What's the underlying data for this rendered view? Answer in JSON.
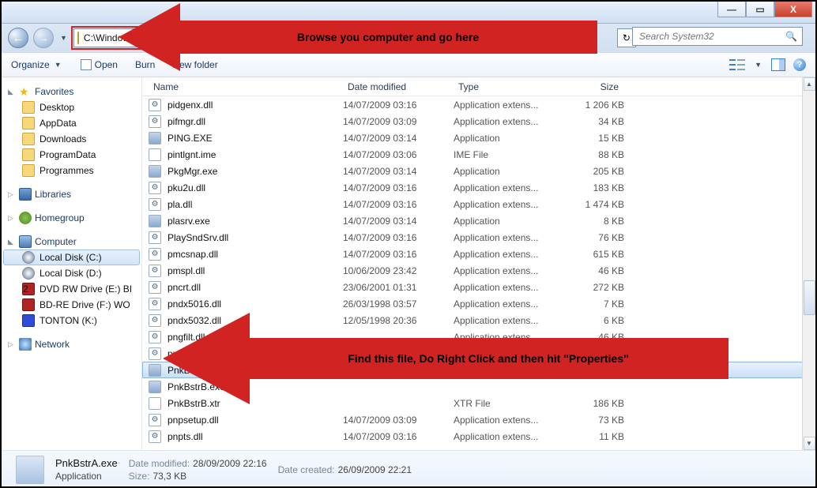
{
  "titlebar": {
    "minimize": "—",
    "maximize": "▭",
    "close": "X"
  },
  "nav": {
    "path": "C:\\Windows\\System32",
    "search_placeholder": "Search System32"
  },
  "annotations": {
    "top": "Browse you computer and go here",
    "mid": "Find this file, Do Right Click and then hit \"Properties\""
  },
  "toolbar": {
    "organize": "Organize",
    "open": "Open",
    "burn": "Burn",
    "newfolder": "New folder"
  },
  "navpane": {
    "favorites": "Favorites",
    "fav_items": [
      "Desktop",
      "AppData",
      "Downloads",
      "ProgramData",
      "Programmes"
    ],
    "libraries": "Libraries",
    "homegroup": "Homegroup",
    "computer": "Computer",
    "comp_items": [
      {
        "label": "Local Disk (C:)",
        "icon": "disc c",
        "sel": true
      },
      {
        "label": "Local Disk (D:)",
        "icon": "disc c"
      },
      {
        "label": "DVD RW Drive (E:) BI",
        "icon": "red",
        "prefix": "2"
      },
      {
        "label": "BD-RE Drive (F:) WO",
        "icon": "red"
      },
      {
        "label": "TONTON (K:)",
        "icon": "blue"
      }
    ],
    "network": "Network"
  },
  "columns": {
    "name": "Name",
    "date": "Date modified",
    "type": "Type",
    "size": "Size"
  },
  "files": [
    {
      "ic": "gear",
      "name": "pidgenx.dll",
      "date": "14/07/2009 03:16",
      "type": "Application extens...",
      "size": "1 206 KB"
    },
    {
      "ic": "gear",
      "name": "pifmgr.dll",
      "date": "14/07/2009 03:09",
      "type": "Application extens...",
      "size": "34 KB"
    },
    {
      "ic": "app",
      "name": "PING.EXE",
      "date": "14/07/2009 03:14",
      "type": "Application",
      "size": "15 KB"
    },
    {
      "ic": "plain",
      "name": "pintlgnt.ime",
      "date": "14/07/2009 03:06",
      "type": "IME File",
      "size": "88 KB"
    },
    {
      "ic": "app",
      "name": "PkgMgr.exe",
      "date": "14/07/2009 03:14",
      "type": "Application",
      "size": "205 KB"
    },
    {
      "ic": "gear",
      "name": "pku2u.dll",
      "date": "14/07/2009 03:16",
      "type": "Application extens...",
      "size": "183 KB"
    },
    {
      "ic": "gear",
      "name": "pla.dll",
      "date": "14/07/2009 03:16",
      "type": "Application extens...",
      "size": "1 474 KB"
    },
    {
      "ic": "app",
      "name": "plasrv.exe",
      "date": "14/07/2009 03:14",
      "type": "Application",
      "size": "8 KB"
    },
    {
      "ic": "gear",
      "name": "PlaySndSrv.dll",
      "date": "14/07/2009 03:16",
      "type": "Application extens...",
      "size": "76 KB"
    },
    {
      "ic": "gear",
      "name": "pmcsnap.dll",
      "date": "14/07/2009 03:16",
      "type": "Application extens...",
      "size": "615 KB"
    },
    {
      "ic": "gear",
      "name": "pmspl.dll",
      "date": "10/06/2009 23:42",
      "type": "Application extens...",
      "size": "46 KB"
    },
    {
      "ic": "gear",
      "name": "pncrt.dll",
      "date": "23/06/2001 01:31",
      "type": "Application extens...",
      "size": "272 KB"
    },
    {
      "ic": "gear",
      "name": "pndx5016.dll",
      "date": "26/03/1998 03:57",
      "type": "Application extens...",
      "size": "7 KB"
    },
    {
      "ic": "gear",
      "name": "pndx5032.dll",
      "date": "12/05/1998 20:36",
      "type": "Application extens...",
      "size": "6 KB"
    },
    {
      "ic": "gear",
      "name": "pngfilt.dll",
      "date": "",
      "type": "Application extens...",
      "size": "46 KB"
    },
    {
      "ic": "gear",
      "name": "pnidui.dll",
      "date": "",
      "type": "",
      "size": ""
    },
    {
      "ic": "app",
      "name": "PnkBstrA.exe",
      "date": "",
      "type": "",
      "size": "",
      "sel": true
    },
    {
      "ic": "app",
      "name": "PnkBstrB.exe",
      "date": "",
      "type": "",
      "size": ""
    },
    {
      "ic": "plain",
      "name": "PnkBstrB.xtr",
      "date": "",
      "type": "XTR File",
      "size": "186 KB"
    },
    {
      "ic": "gear",
      "name": "pnpsetup.dll",
      "date": "14/07/2009 03:09",
      "type": "Application extens...",
      "size": "73 KB"
    },
    {
      "ic": "gear",
      "name": "pnpts.dll",
      "date": "14/07/2009 03:16",
      "type": "Application extens...",
      "size": "11 KB"
    }
  ],
  "details": {
    "filename": "PnkBstrA.exe",
    "filetype": "Application",
    "modified_label": "Date modified:",
    "modified": "28/09/2009 22:16",
    "size_label": "Size:",
    "size": "73,3 KB",
    "created_label": "Date created:",
    "created": "26/09/2009 22:21"
  }
}
